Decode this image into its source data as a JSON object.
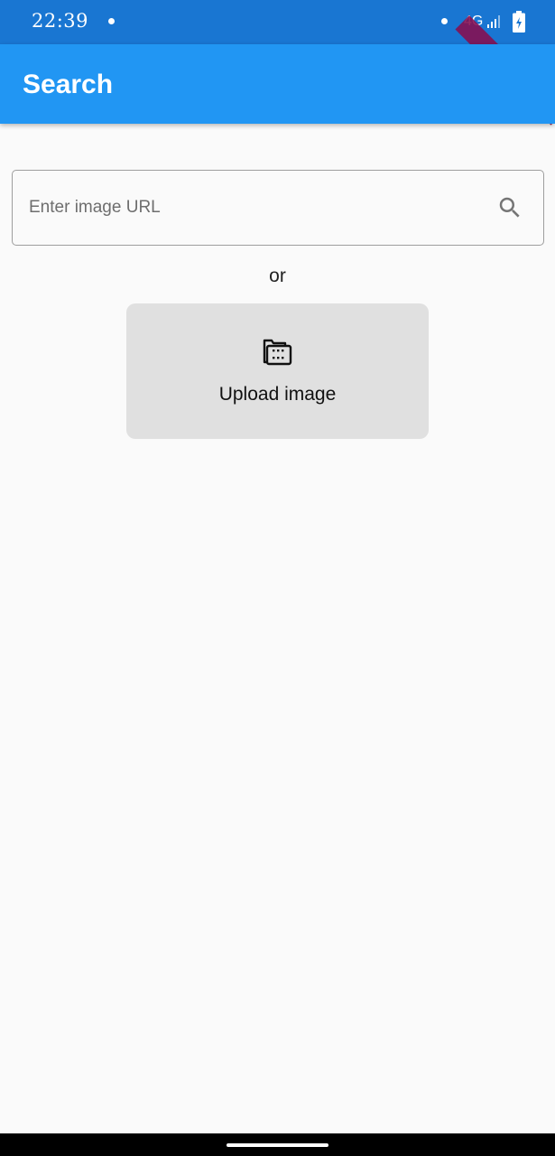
{
  "status_bar": {
    "time": "22:39",
    "network": "4G",
    "icons": [
      "notification-dot-icon",
      "signal-icon",
      "battery-charging-icon"
    ]
  },
  "debug_banner": "DEBUG",
  "app_bar": {
    "title": "Search",
    "color": "#2196f3",
    "status_color": "#1976d2"
  },
  "search": {
    "placeholder": "Enter image URL",
    "value": "",
    "icon": "search-icon"
  },
  "divider_text": "or",
  "upload": {
    "label": "Upload image",
    "icon": "folder-photo-icon"
  }
}
